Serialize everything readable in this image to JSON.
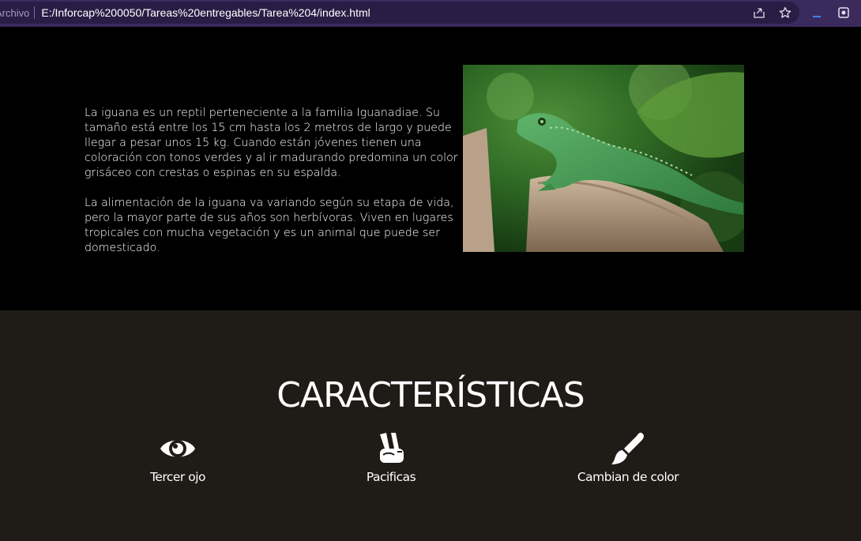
{
  "browser": {
    "scheme_label": "Archivo",
    "url": "E:/Inforcap%200050/Tareas%20entregables/Tarea%204/index.html",
    "icons": [
      "share-icon",
      "star-icon",
      "extension-icon",
      "tab-icon"
    ]
  },
  "hero": {
    "paragraphs": [
      "La iguana es un reptil perteneciente a la familia Iguanadiae. Su tamaño está entre los 15 cm hasta los 2 metros de largo y puede llegar a pesar unos 15 kg. Cuando están jóvenes tienen una coloración con tonos verdes y al ir madurando predomina un color grisáceo con crestas o espinas en su espalda.",
      "La alimentación de la iguana va variando según su etapa de vida, pero la mayor parte de sus años son herbívoras. Viven en lugares tropicales con mucha vegetación y es un animal que puede ser domesticado."
    ],
    "image": "iguana-photo"
  },
  "features": {
    "title": "CARACTERÍSTICAS",
    "items": [
      {
        "icon": "eye-icon",
        "label": "Tercer ojo"
      },
      {
        "icon": "peace-hand-icon",
        "label": "Pacificas"
      },
      {
        "icon": "paintbrush-icon",
        "label": "Cambian de color"
      }
    ]
  },
  "colors": {
    "browser_bar": "#3b2a5c",
    "hero_bg": "#000000",
    "features_bg": "#1f1b16",
    "text": "#ffffff"
  }
}
